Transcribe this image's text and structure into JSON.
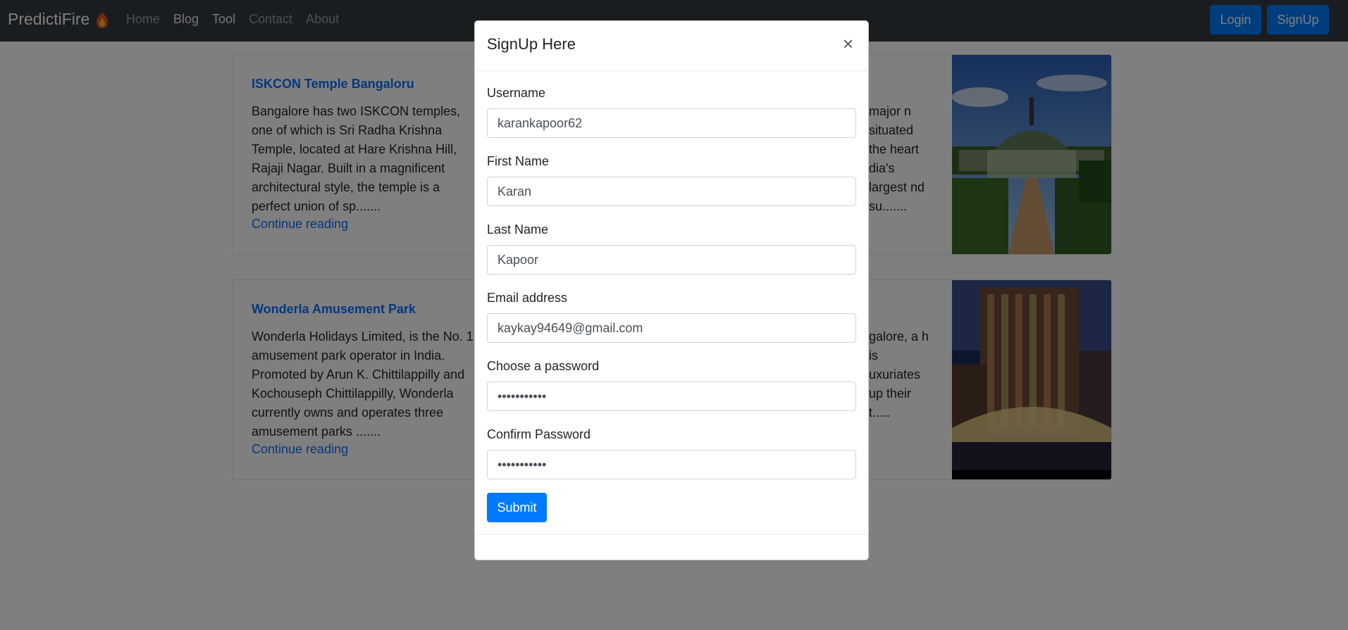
{
  "navbar": {
    "brand": "PredictiFire",
    "brand_icon": "fire-icon",
    "links": [
      "Home",
      "Blog",
      "Tool",
      "Contact",
      "About"
    ],
    "login_label": "Login",
    "signup_label": "SignUp"
  },
  "cards": [
    {
      "title": "ISKCON Temple Bangaloru",
      "text": "Bangalore has two ISKCON temples, one of which is Sri Radha Krishna Temple, located at Hare Krishna Hill, Rajaji Nagar. Built in a magnificent architectural style, the temple is a perfect union of sp.......",
      "link": "Continue reading"
    },
    {
      "text_partial": "major n situated the heart dia's largest nd su.......",
      "image": "glass-house-garden"
    },
    {
      "title": "Wonderla Amusement Park",
      "text": "Wonderla Holidays Limited, is the No. 1 amusement park operator in India. Promoted by Arun K. Chittilappilly and Kochouseph Chittilappilly, Wonderla currently owns and operates three amusement parks .......",
      "link": "Continue reading"
    },
    {
      "text_partial": "galore, a h is uxuriates up their t.....",
      "image": "hotel-building-night"
    }
  ],
  "modal": {
    "title": "SignUp Here",
    "close_symbol": "×",
    "fields": [
      {
        "label": "Username",
        "value": "karankapoor62",
        "type": "text"
      },
      {
        "label": "First Name",
        "value": "Karan",
        "type": "text"
      },
      {
        "label": "Last Name",
        "value": "Kapoor",
        "type": "text"
      },
      {
        "label": "Email address",
        "value": "kaykay94649@gmail.com",
        "type": "email"
      },
      {
        "label": "Choose a password",
        "value": "password123",
        "type": "password"
      },
      {
        "label": "Confirm Password",
        "value": "password123",
        "type": "password"
      }
    ],
    "submit_label": "Submit"
  },
  "colors": {
    "navbar_bg": "#343a40",
    "primary": "#007bff",
    "link": "#0d6efd"
  }
}
